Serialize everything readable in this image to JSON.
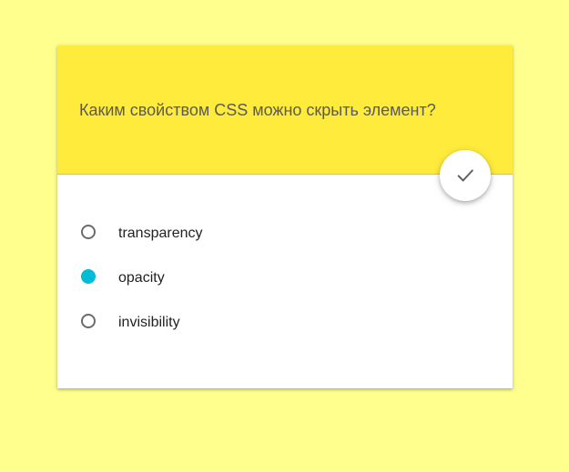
{
  "quiz": {
    "question": "Каким свойством CSS можно скрыть элемент?",
    "submit_icon": "check-icon",
    "options": [
      {
        "label": "transparency",
        "selected": false
      },
      {
        "label": "opacity",
        "selected": true
      },
      {
        "label": "invisibility",
        "selected": false
      }
    ]
  },
  "colors": {
    "page_background": "#ffff8d",
    "header_background": "#ffeb3b",
    "accent": "#00bcd4"
  }
}
